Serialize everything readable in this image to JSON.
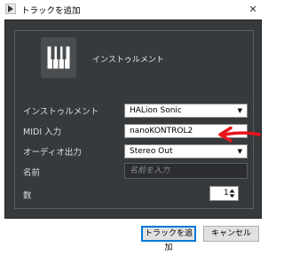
{
  "window": {
    "title": "トラックを追加",
    "close_glyph": "✕"
  },
  "header": {
    "track_type": "インストゥルメント",
    "icon": "piano-keys-icon"
  },
  "fields": {
    "instrument": {
      "label": "インストゥルメント",
      "value": "HALion Sonic"
    },
    "midi_input": {
      "label": "MIDI 入力",
      "value": "nanoKONTROL2"
    },
    "audio_output": {
      "label": "オーディオ出力",
      "value": "Stereo Out"
    },
    "name": {
      "label": "名前",
      "value": "",
      "placeholder": "名前を入力"
    },
    "count": {
      "label": "数",
      "value": "1"
    }
  },
  "buttons": {
    "add_track": "トラックを追加",
    "cancel": "キャンセル"
  },
  "colors": {
    "panel_bg": "#373a3d",
    "annotation_arrow": "#e8141b",
    "primary_border": "#0078d7"
  },
  "dropdown_glyph": "▼"
}
